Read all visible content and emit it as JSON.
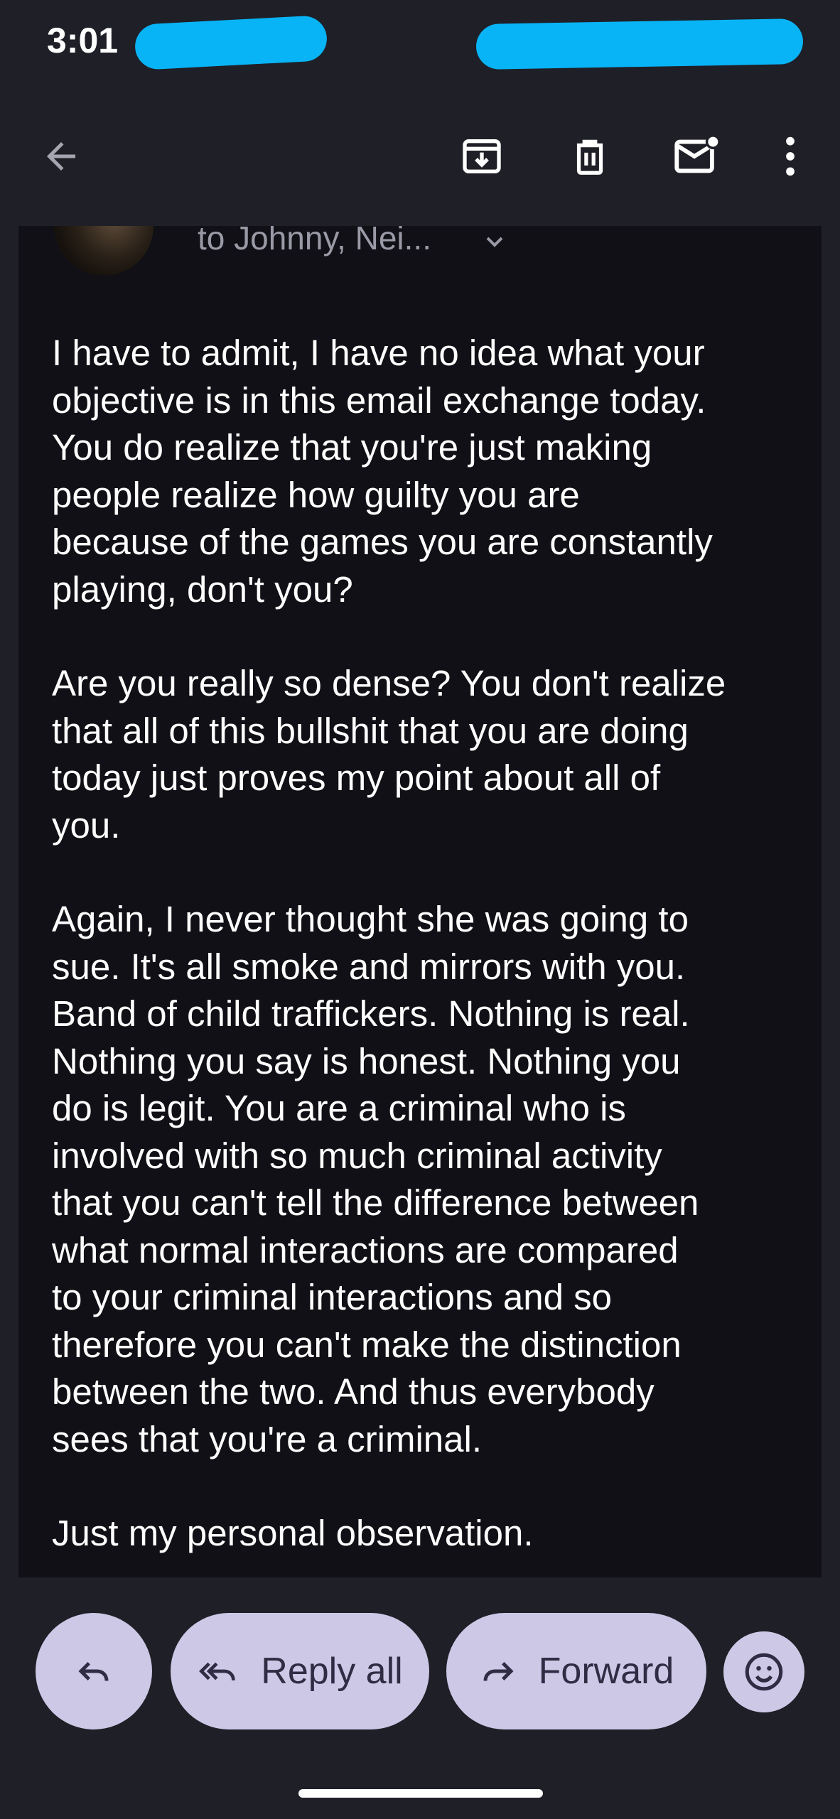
{
  "status_bar": {
    "time": "3:01"
  },
  "toolbar": {
    "back_icon": "arrow-left-icon",
    "archive_icon": "archive-icon",
    "delete_icon": "trash-icon",
    "mark_unread_icon": "mail-unread-icon",
    "more_icon": "more-vert-icon"
  },
  "email": {
    "recipients": "to Johnny, Nei...",
    "paragraphs": [
      "I have to admit, I have no idea what your\nobjective is in this email exchange today.\nYou do realize that you're just making\npeople realize how guilty you are\nbecause of the games you are constantly\nplaying, don't you?",
      "Are you really so dense? You don't realize\nthat all of this bullshit that you are doing\ntoday just proves my point about all of\nyou.",
      "Again, I never thought she was going to\nsue. It's all smoke and mirrors with you.\nBand of child traffickers. Nothing is real.\nNothing you say is honest. Nothing you\ndo is legit. You are a criminal who is\ninvolved with so much criminal activity\nthat you can't tell the difference between\nwhat normal interactions are compared\nto your criminal interactions and so\ntherefore you can't make the distinction\nbetween the two. And thus everybody\nsees that you're a criminal.",
      "Just my personal observation."
    ]
  },
  "actions": {
    "reply_icon": "reply-icon",
    "reply_all_label": "Reply all",
    "forward_label": "Forward",
    "emoji_icon": "smiley-icon"
  },
  "colors": {
    "background": "#1f1f27",
    "card": "#101016",
    "button": "#cdc8e6",
    "redaction": "#08b4f6"
  }
}
